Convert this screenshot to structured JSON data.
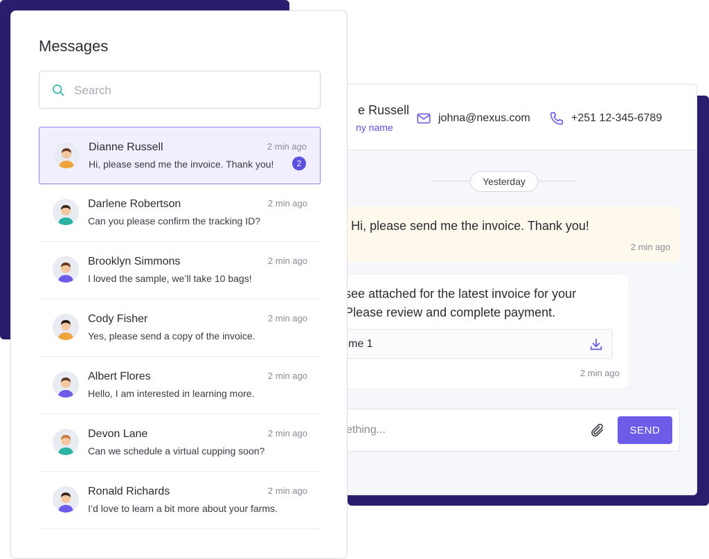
{
  "colors": {
    "accent": "#6c5ce7",
    "backdrop": "#2a1d6e",
    "incoming_bubble": "#fff8ec"
  },
  "messages_panel": {
    "title": "Messages",
    "search": {
      "placeholder": "Search",
      "icon": "search-icon"
    },
    "conversations": [
      {
        "name": "Dianne Russell",
        "time": "2 min ago",
        "preview": "Hi, please send me the invoice. Thank you!",
        "unread": "2",
        "active": true,
        "avatar_shirt": "#f0a33a",
        "avatar_hair": "#6b3a1e"
      },
      {
        "name": "Darlene Robertson",
        "time": "2 min ago",
        "preview": "Can you please confirm the tracking ID?",
        "avatar_shirt": "#2bb3a3",
        "avatar_hair": "#3a2a1e"
      },
      {
        "name": "Brooklyn Simmons",
        "time": "2 min ago",
        "preview": "I loved the sample, we’ll take 10 bags!",
        "avatar_shirt": "#6c5ce7",
        "avatar_hair": "#6b3a1e"
      },
      {
        "name": "Cody Fisher",
        "time": "2 min ago",
        "preview": "Yes, please send a copy of the invoice.",
        "avatar_shirt": "#f0a33a",
        "avatar_hair": "#2b1a12"
      },
      {
        "name": "Albert Flores",
        "time": "2 min ago",
        "preview": "Hello, I am interested in learning more.",
        "avatar_shirt": "#6c5ce7",
        "avatar_hair": "#5a3a28"
      },
      {
        "name": "Devon Lane",
        "time": "2 min ago",
        "preview": "Can we schedule a virtual cupping soon?",
        "avatar_shirt": "#2bb3a3",
        "avatar_hair": "#c97a3a"
      },
      {
        "name": "Ronald Richards",
        "time": "2 min ago",
        "preview": "I’d love to learn a bit more about your farms.",
        "avatar_shirt": "#6c5ce7",
        "avatar_hair": "#3a2418"
      }
    ]
  },
  "chat": {
    "contact": {
      "name": "e Russell",
      "company": "ny name",
      "email": "johna@nexus.com",
      "phone": "+251 12-345-6789",
      "email_icon": "mail-icon",
      "phone_icon": "phone-icon"
    },
    "date_divider": "Yesterday",
    "incoming": {
      "text": "Hi, please send me the invoice. Thank you!",
      "time": "2 min ago"
    },
    "outgoing": {
      "line1": "see attached for the latest invoice for your",
      "line2": "Please review and complete payment.",
      "attachment": "me 1",
      "attachment_icon": "download-icon",
      "time": "2 min ago"
    },
    "composer": {
      "placeholder": "ething...",
      "attach_icon": "paperclip-icon",
      "send_label": "SEND"
    }
  }
}
